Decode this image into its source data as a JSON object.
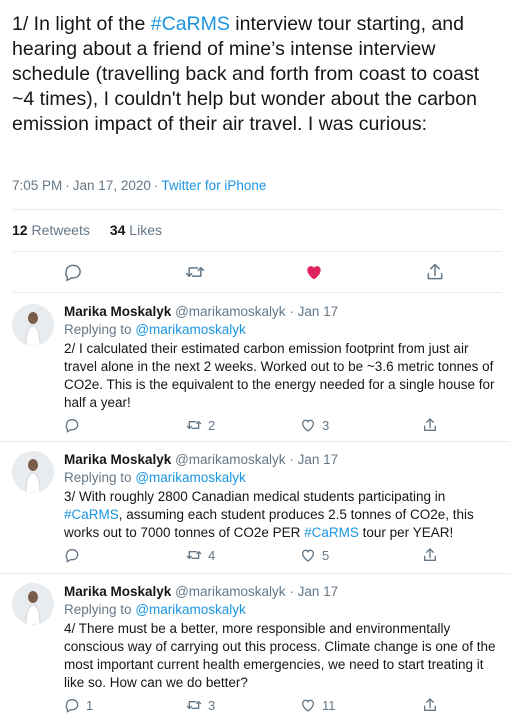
{
  "main": {
    "text_before": "1/ In light of the ",
    "hashtag": "#CaRMS",
    "text_after": " interview tour starting, and hearing about a friend of mine’s intense interview schedule (travelling back and forth from coast to coast ~4 times), I couldn't help but wonder about the carbon emission impact of their air travel. I was curious:",
    "time": "7:05 PM",
    "date": "Jan 17, 2020",
    "source": "Twitter for iPhone",
    "retweets_count": "12",
    "retweets_label": "Retweets",
    "likes_count": "34",
    "likes_label": "Likes",
    "like_color": "#e0245e"
  },
  "replies": [
    {
      "name": "Marika Moskalyk",
      "handle": "@marikamoskalyk",
      "date": "Jan 17",
      "replying_label": "Replying to",
      "replying_to": "@marikamoskalyk",
      "text_1": "2/ I calculated their estimated carbon emission footprint from just air travel alone in the next 2 weeks. Worked out to be ~3.6 metric tonnes of CO2e. This is the equivalent to the energy needed for a single house for half a year!",
      "reply_count": "",
      "retweet_count": "2",
      "like_count": "3"
    },
    {
      "name": "Marika Moskalyk",
      "handle": "@marikamoskalyk",
      "date": "Jan 17",
      "replying_label": "Replying to",
      "replying_to": "@marikamoskalyk",
      "text_1": "3/ With roughly 2800 Canadian medical students participating in ",
      "hashtag_1": "#CaRMS",
      "text_2": ", assuming each student produces 2.5 tonnes of CO2e, this works out to 7000 tonnes of CO2e PER ",
      "hashtag_2": "#CaRMS",
      "text_3": " tour per YEAR!",
      "reply_count": "",
      "retweet_count": "4",
      "like_count": "5"
    },
    {
      "name": "Marika Moskalyk",
      "handle": "@marikamoskalyk",
      "date": "Jan 17",
      "replying_label": "Replying to",
      "replying_to": "@marikamoskalyk",
      "text_1": "4/ There must be a better, more responsible and environmentally conscious way of carrying out this process. Climate change is one of the most important current health emergencies, we need to start treating it like so. How can we do better?",
      "reply_count": "1",
      "retweet_count": "3",
      "like_count": "11"
    }
  ]
}
